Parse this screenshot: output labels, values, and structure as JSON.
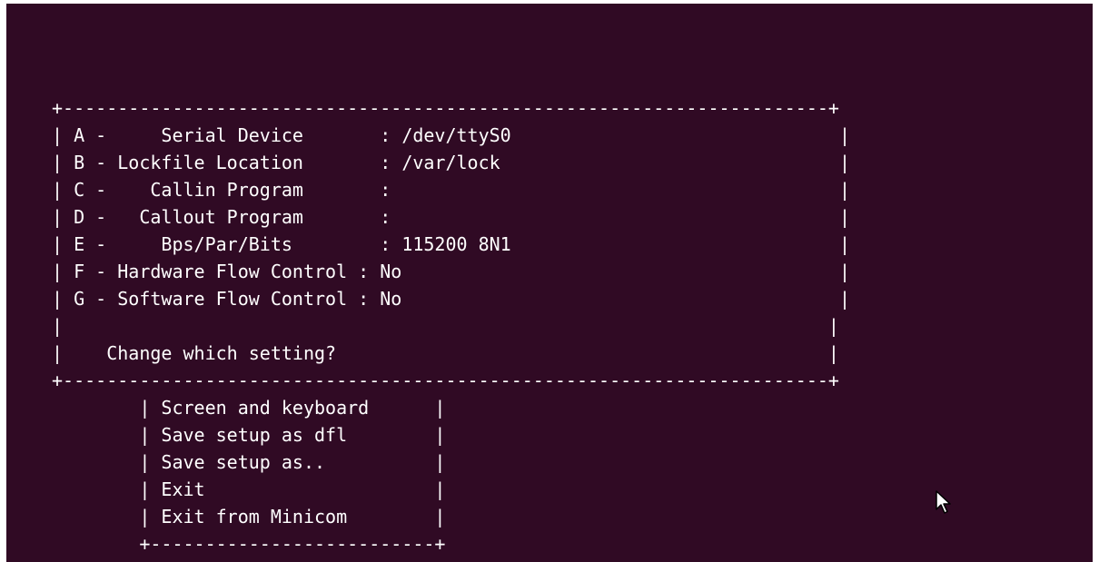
{
  "terminal": {
    "background": "#300a24",
    "foreground": "#ffffff",
    "lines": [
      "+----------------------------------------------------------------------+",
      "| A -     Serial Device       : /dev/ttyS0                              |",
      "| B - Lockfile Location       : /var/lock                               |",
      "| C -    Callin Program       :                                         |",
      "| D -   Callout Program       :                                         |",
      "| E -     Bps/Par/Bits        : 115200 8N1                              |",
      "| F - Hardware Flow Control : No                                        |",
      "| G - Software Flow Control : No                                        |",
      "|                                                                      |",
      "|    Change which setting?                                             |",
      "+----------------------------------------------------------------------+",
      "        | Screen and keyboard      |",
      "        | Save setup as dfl        |",
      "        | Save setup as..          |",
      "        | Exit                     |",
      "        | Exit from Minicom        |",
      "        +--------------------------+"
    ]
  },
  "cursor_icon": "mouse-pointer-icon"
}
